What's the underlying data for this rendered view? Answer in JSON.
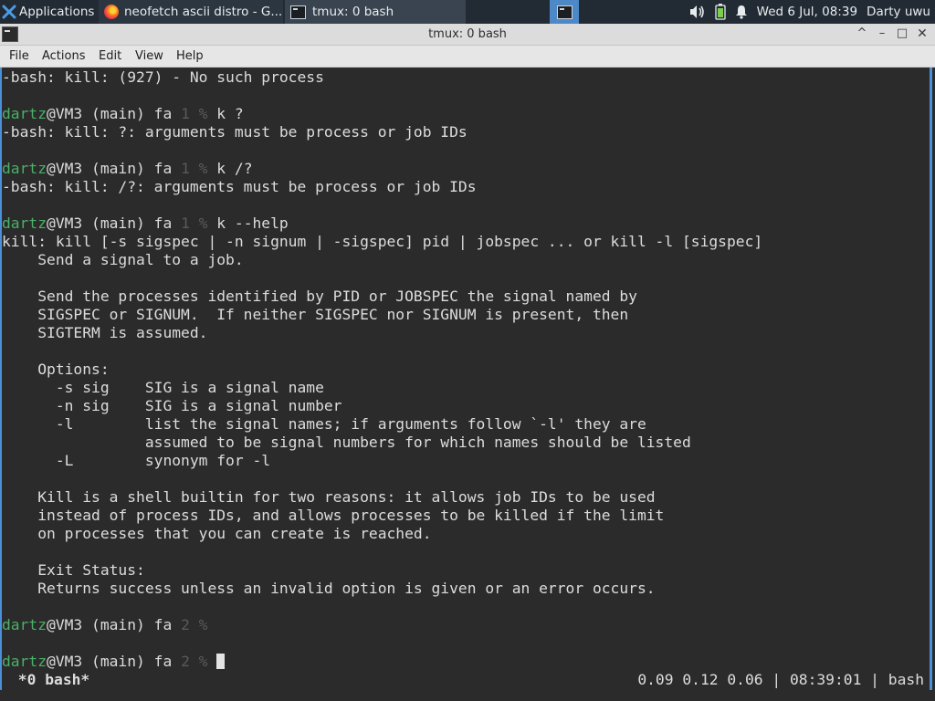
{
  "panel": {
    "apps_label": "Applications",
    "tasks": [
      {
        "label": "neofetch ascii distro - G..."
      },
      {
        "label": "tmux: 0 bash"
      }
    ],
    "clock": "Wed  6 Jul, 08:39",
    "user": "Darty uwu"
  },
  "window": {
    "title": "tmux: 0 bash",
    "buttons": {
      "up": "^",
      "minimize": "–",
      "maximize": "□",
      "close": "✕"
    }
  },
  "menu": [
    "File",
    "Actions",
    "Edit",
    "View",
    "Help"
  ],
  "prompt": {
    "user": "dartz",
    "host": "@VM3 (main) fa ",
    "pct": " %"
  },
  "terminal": {
    "lines": [
      {
        "type": "out",
        "text": "-bash: kill: (927) - No such process"
      },
      {
        "type": "blank"
      },
      {
        "type": "prompt",
        "num": "1",
        "cmd": " k ?"
      },
      {
        "type": "out",
        "text": "-bash: kill: ?: arguments must be process or job IDs"
      },
      {
        "type": "blank"
      },
      {
        "type": "prompt",
        "num": "1",
        "cmd": " k /?"
      },
      {
        "type": "out",
        "text": "-bash: kill: /?: arguments must be process or job IDs"
      },
      {
        "type": "blank"
      },
      {
        "type": "prompt",
        "num": "1",
        "cmd": " k --help"
      },
      {
        "type": "out",
        "text": "kill: kill [-s sigspec | -n signum | -sigspec] pid | jobspec ... or kill -l [sigspec]"
      },
      {
        "type": "out",
        "text": "    Send a signal to a job."
      },
      {
        "type": "blank"
      },
      {
        "type": "out",
        "text": "    Send the processes identified by PID or JOBSPEC the signal named by"
      },
      {
        "type": "out",
        "text": "    SIGSPEC or SIGNUM.  If neither SIGSPEC nor SIGNUM is present, then"
      },
      {
        "type": "out",
        "text": "    SIGTERM is assumed."
      },
      {
        "type": "blank"
      },
      {
        "type": "out",
        "text": "    Options:"
      },
      {
        "type": "out",
        "text": "      -s sig    SIG is a signal name"
      },
      {
        "type": "out",
        "text": "      -n sig    SIG is a signal number"
      },
      {
        "type": "out",
        "text": "      -l        list the signal names; if arguments follow `-l' they are"
      },
      {
        "type": "out",
        "text": "                assumed to be signal numbers for which names should be listed"
      },
      {
        "type": "out",
        "text": "      -L        synonym for -l"
      },
      {
        "type": "blank"
      },
      {
        "type": "out",
        "text": "    Kill is a shell builtin for two reasons: it allows job IDs to be used"
      },
      {
        "type": "out",
        "text": "    instead of process IDs, and allows processes to be killed if the limit"
      },
      {
        "type": "out",
        "text": "    on processes that you can create is reached."
      },
      {
        "type": "blank"
      },
      {
        "type": "out",
        "text": "    Exit Status:"
      },
      {
        "type": "out",
        "text": "    Returns success unless an invalid option is given or an error occurs."
      },
      {
        "type": "blank"
      },
      {
        "type": "prompt",
        "num": "2",
        "cmd": ""
      },
      {
        "type": "blank"
      },
      {
        "type": "prompt",
        "num": "2",
        "cmd": " ",
        "cursor": true
      }
    ]
  },
  "status": {
    "left": " *0 bash*",
    "right": "0.09 0.12 0.06 | 08:39:01 | bash"
  }
}
